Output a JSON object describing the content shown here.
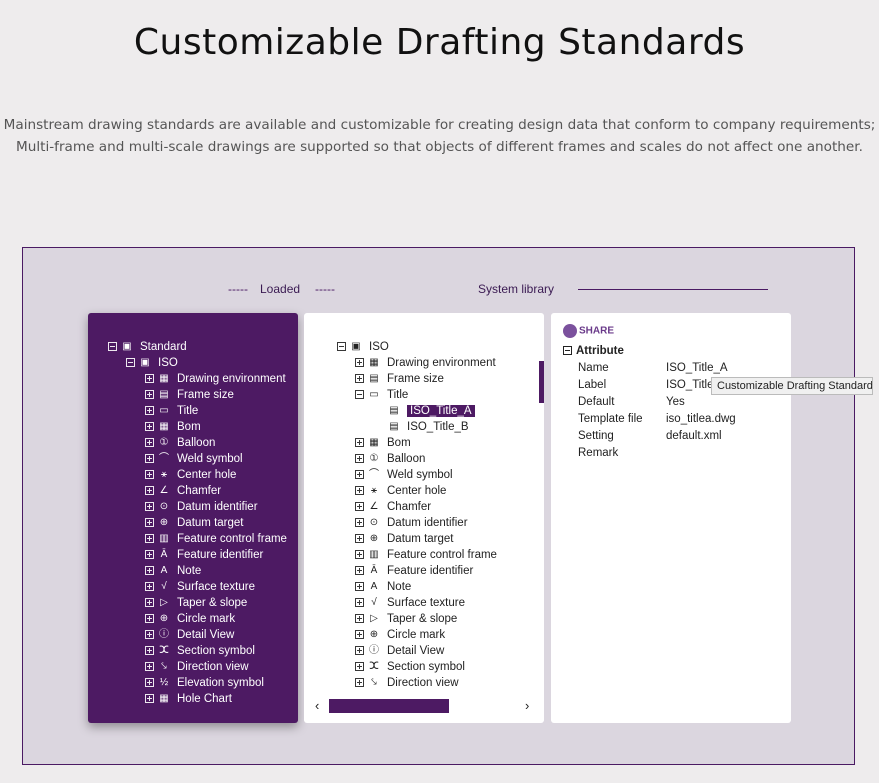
{
  "page": {
    "title": "Customizable Drafting Standards",
    "desc_line1": "Mainstream drawing standards are available and customizable for creating design data that conform to company requirements;",
    "desc_line2": "Multi-frame and multi-scale drawings are supported so that objects of different frames and scales do not affect one another."
  },
  "headers": {
    "dash": "-----",
    "loaded": "Loaded",
    "system": "System library"
  },
  "loaded_tree": {
    "root": "Standard",
    "child": "ISO",
    "items": [
      "Drawing environment",
      "Frame size",
      "Title",
      "Bom",
      "Balloon",
      "Weld symbol",
      "Center hole",
      "Chamfer",
      "Datum identifier",
      "Datum target",
      "Feature control frame",
      "Feature identifier",
      "Note",
      "Surface texture",
      "Taper & slope",
      "Circle mark",
      "Detail View",
      "Section symbol",
      "Direction view",
      "Elevation symbol",
      "Hole Chart"
    ]
  },
  "system_tree": {
    "root": "ISO",
    "items_before": [
      "Drawing environment",
      "Frame size"
    ],
    "expanded": "Title",
    "sub_items": [
      "ISO_Title_A",
      "ISO_Title_B"
    ],
    "items_after": [
      "Bom",
      "Balloon",
      "Weld symbol",
      "Center hole",
      "Chamfer",
      "Datum identifier",
      "Datum target",
      "Feature control frame",
      "Feature identifier",
      "Note",
      "Surface texture",
      "Taper & slope",
      "Circle mark",
      "Detail View",
      "Section symbol",
      "Direction view"
    ]
  },
  "attributes": {
    "share": "SHARE",
    "heading": "Attribute",
    "rows": [
      {
        "k": "Name",
        "v": "ISO_Title_A"
      },
      {
        "k": "Label",
        "v": "ISO_Title"
      },
      {
        "k": "Default",
        "v": "Yes"
      },
      {
        "k": "Template file",
        "v": "iso_titlea.dwg"
      },
      {
        "k": "Setting",
        "v": "default.xml"
      },
      {
        "k": "Remark",
        "v": ""
      }
    ]
  },
  "tooltip": "Customizable Drafting Standards",
  "icons": {
    "tree_item": "folder-icon",
    "expand": "expander-icon",
    "scroll_left": "arrow-left-icon",
    "scroll_right": "arrow-right-icon"
  },
  "colors": {
    "accent": "#4d1a63",
    "frame_bg": "#dbd6df",
    "page_bg": "#eeeced"
  }
}
